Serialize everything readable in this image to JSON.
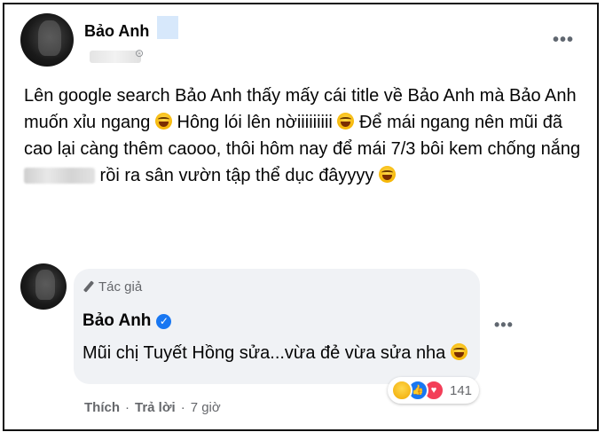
{
  "post": {
    "author": "Bảo Anh",
    "text_parts": {
      "p1": "Lên google search Bảo Anh thấy mấy cái title về Bảo Anh mà Bảo Anh muốn xỉu ngang ",
      "p2": " Hông lói lên nờiiiiiiiii ",
      "p3": " Để mái ngang nên mũi đã cao lại càng thêm caooo, thôi hôm nay để mái 7/3  bôi kem chống nắng ",
      "p4": " rồi ra sân vườn tập thể dục đâyyyy "
    },
    "more_icon": "more-horizontal-icon"
  },
  "comment": {
    "badge": "Tác giả",
    "author": "Bảo Anh",
    "text": "Mũi chị Tuyết Hồng sửa...vừa đẻ vừa sửa nha",
    "reaction_count": "141",
    "actions": {
      "like": "Thích",
      "reply": "Trả lời",
      "time": "7 giờ",
      "separator": "·"
    }
  },
  "colors": {
    "text": "#050505",
    "secondary": "#65676b",
    "bubble": "#f0f2f5",
    "verified": "#1877f2",
    "love": "#f33e58"
  }
}
